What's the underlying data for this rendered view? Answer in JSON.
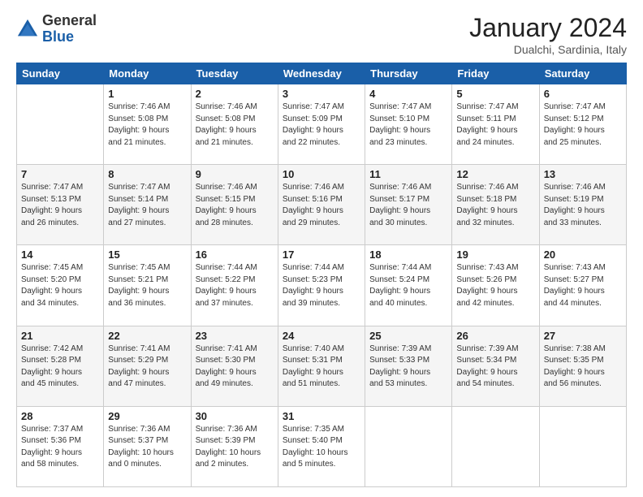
{
  "logo": {
    "general": "General",
    "blue": "Blue"
  },
  "title": "January 2024",
  "location": "Dualchi, Sardinia, Italy",
  "weekdays": [
    "Sunday",
    "Monday",
    "Tuesday",
    "Wednesday",
    "Thursday",
    "Friday",
    "Saturday"
  ],
  "weeks": [
    [
      {
        "day": "",
        "sunrise": "",
        "sunset": "",
        "daylight": ""
      },
      {
        "day": "1",
        "sunrise": "Sunrise: 7:46 AM",
        "sunset": "Sunset: 5:08 PM",
        "daylight": "Daylight: 9 hours and 21 minutes."
      },
      {
        "day": "2",
        "sunrise": "Sunrise: 7:46 AM",
        "sunset": "Sunset: 5:08 PM",
        "daylight": "Daylight: 9 hours and 21 minutes."
      },
      {
        "day": "3",
        "sunrise": "Sunrise: 7:47 AM",
        "sunset": "Sunset: 5:09 PM",
        "daylight": "Daylight: 9 hours and 22 minutes."
      },
      {
        "day": "4",
        "sunrise": "Sunrise: 7:47 AM",
        "sunset": "Sunset: 5:10 PM",
        "daylight": "Daylight: 9 hours and 23 minutes."
      },
      {
        "day": "5",
        "sunrise": "Sunrise: 7:47 AM",
        "sunset": "Sunset: 5:11 PM",
        "daylight": "Daylight: 9 hours and 24 minutes."
      },
      {
        "day": "6",
        "sunrise": "Sunrise: 7:47 AM",
        "sunset": "Sunset: 5:12 PM",
        "daylight": "Daylight: 9 hours and 25 minutes."
      }
    ],
    [
      {
        "day": "7",
        "sunrise": "Sunrise: 7:47 AM",
        "sunset": "Sunset: 5:13 PM",
        "daylight": "Daylight: 9 hours and 26 minutes."
      },
      {
        "day": "8",
        "sunrise": "Sunrise: 7:47 AM",
        "sunset": "Sunset: 5:14 PM",
        "daylight": "Daylight: 9 hours and 27 minutes."
      },
      {
        "day": "9",
        "sunrise": "Sunrise: 7:46 AM",
        "sunset": "Sunset: 5:15 PM",
        "daylight": "Daylight: 9 hours and 28 minutes."
      },
      {
        "day": "10",
        "sunrise": "Sunrise: 7:46 AM",
        "sunset": "Sunset: 5:16 PM",
        "daylight": "Daylight: 9 hours and 29 minutes."
      },
      {
        "day": "11",
        "sunrise": "Sunrise: 7:46 AM",
        "sunset": "Sunset: 5:17 PM",
        "daylight": "Daylight: 9 hours and 30 minutes."
      },
      {
        "day": "12",
        "sunrise": "Sunrise: 7:46 AM",
        "sunset": "Sunset: 5:18 PM",
        "daylight": "Daylight: 9 hours and 32 minutes."
      },
      {
        "day": "13",
        "sunrise": "Sunrise: 7:46 AM",
        "sunset": "Sunset: 5:19 PM",
        "daylight": "Daylight: 9 hours and 33 minutes."
      }
    ],
    [
      {
        "day": "14",
        "sunrise": "Sunrise: 7:45 AM",
        "sunset": "Sunset: 5:20 PM",
        "daylight": "Daylight: 9 hours and 34 minutes."
      },
      {
        "day": "15",
        "sunrise": "Sunrise: 7:45 AM",
        "sunset": "Sunset: 5:21 PM",
        "daylight": "Daylight: 9 hours and 36 minutes."
      },
      {
        "day": "16",
        "sunrise": "Sunrise: 7:44 AM",
        "sunset": "Sunset: 5:22 PM",
        "daylight": "Daylight: 9 hours and 37 minutes."
      },
      {
        "day": "17",
        "sunrise": "Sunrise: 7:44 AM",
        "sunset": "Sunset: 5:23 PM",
        "daylight": "Daylight: 9 hours and 39 minutes."
      },
      {
        "day": "18",
        "sunrise": "Sunrise: 7:44 AM",
        "sunset": "Sunset: 5:24 PM",
        "daylight": "Daylight: 9 hours and 40 minutes."
      },
      {
        "day": "19",
        "sunrise": "Sunrise: 7:43 AM",
        "sunset": "Sunset: 5:26 PM",
        "daylight": "Daylight: 9 hours and 42 minutes."
      },
      {
        "day": "20",
        "sunrise": "Sunrise: 7:43 AM",
        "sunset": "Sunset: 5:27 PM",
        "daylight": "Daylight: 9 hours and 44 minutes."
      }
    ],
    [
      {
        "day": "21",
        "sunrise": "Sunrise: 7:42 AM",
        "sunset": "Sunset: 5:28 PM",
        "daylight": "Daylight: 9 hours and 45 minutes."
      },
      {
        "day": "22",
        "sunrise": "Sunrise: 7:41 AM",
        "sunset": "Sunset: 5:29 PM",
        "daylight": "Daylight: 9 hours and 47 minutes."
      },
      {
        "day": "23",
        "sunrise": "Sunrise: 7:41 AM",
        "sunset": "Sunset: 5:30 PM",
        "daylight": "Daylight: 9 hours and 49 minutes."
      },
      {
        "day": "24",
        "sunrise": "Sunrise: 7:40 AM",
        "sunset": "Sunset: 5:31 PM",
        "daylight": "Daylight: 9 hours and 51 minutes."
      },
      {
        "day": "25",
        "sunrise": "Sunrise: 7:39 AM",
        "sunset": "Sunset: 5:33 PM",
        "daylight": "Daylight: 9 hours and 53 minutes."
      },
      {
        "day": "26",
        "sunrise": "Sunrise: 7:39 AM",
        "sunset": "Sunset: 5:34 PM",
        "daylight": "Daylight: 9 hours and 54 minutes."
      },
      {
        "day": "27",
        "sunrise": "Sunrise: 7:38 AM",
        "sunset": "Sunset: 5:35 PM",
        "daylight": "Daylight: 9 hours and 56 minutes."
      }
    ],
    [
      {
        "day": "28",
        "sunrise": "Sunrise: 7:37 AM",
        "sunset": "Sunset: 5:36 PM",
        "daylight": "Daylight: 9 hours and 58 minutes."
      },
      {
        "day": "29",
        "sunrise": "Sunrise: 7:36 AM",
        "sunset": "Sunset: 5:37 PM",
        "daylight": "Daylight: 10 hours and 0 minutes."
      },
      {
        "day": "30",
        "sunrise": "Sunrise: 7:36 AM",
        "sunset": "Sunset: 5:39 PM",
        "daylight": "Daylight: 10 hours and 2 minutes."
      },
      {
        "day": "31",
        "sunrise": "Sunrise: 7:35 AM",
        "sunset": "Sunset: 5:40 PM",
        "daylight": "Daylight: 10 hours and 5 minutes."
      },
      {
        "day": "",
        "sunrise": "",
        "sunset": "",
        "daylight": ""
      },
      {
        "day": "",
        "sunrise": "",
        "sunset": "",
        "daylight": ""
      },
      {
        "day": "",
        "sunrise": "",
        "sunset": "",
        "daylight": ""
      }
    ]
  ]
}
